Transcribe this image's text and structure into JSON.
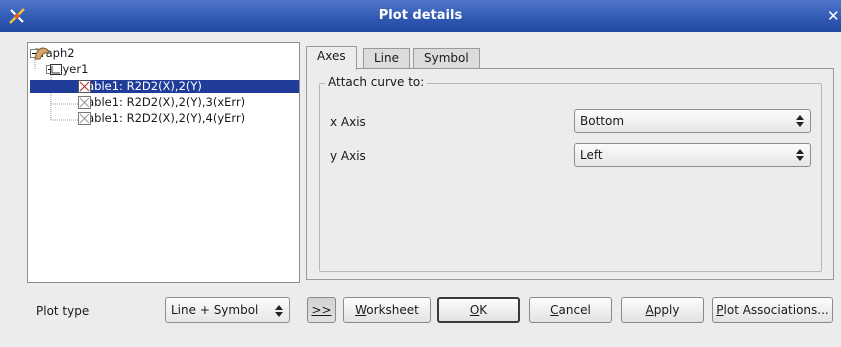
{
  "window": {
    "title": "Plot details",
    "close_glyph": "✕"
  },
  "tree": {
    "graph": "Graph2",
    "layer": "Layer1",
    "curves": [
      "Table1: R2D2(X),2(Y)",
      "Table1: R2D2(X),2(Y),3(xErr)",
      "Table1: R2D2(X),2(Y),4(yErr)"
    ]
  },
  "tabs": [
    "Axes",
    "Line",
    "Symbol"
  ],
  "axes_panel": {
    "group_title": "Attach curve to:",
    "x_label": "x Axis",
    "x_value": "Bottom",
    "y_label": "y Axis",
    "y_value": "Left"
  },
  "footer": {
    "plot_type_label": "Plot type",
    "plot_type_value": "Line + Symbol",
    "expand_button": ">>",
    "worksheet": {
      "mnemonic": "W",
      "rest": "orksheet"
    },
    "ok": {
      "mnemonic": "O",
      "rest": "K"
    },
    "cancel": {
      "mnemonic": "C",
      "rest": "ancel"
    },
    "apply": {
      "mnemonic": "A",
      "rest": "pply"
    },
    "associations": {
      "mnemonic": "P",
      "rest": "lot Associations..."
    }
  }
}
